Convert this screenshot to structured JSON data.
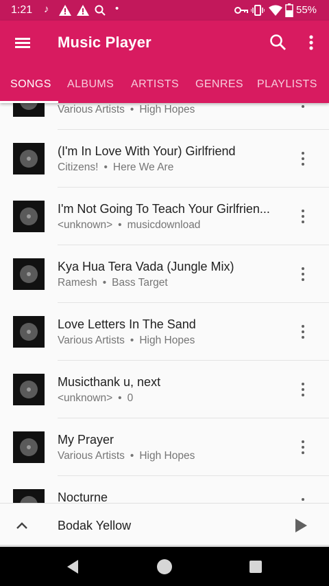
{
  "status_bar": {
    "time": "1:21",
    "battery": "55%",
    "icons": [
      "music-note-icon",
      "warning-icon",
      "warning-icon",
      "search-icon",
      "dot-icon",
      "vpn-key-icon",
      "vibrate-icon",
      "wifi-icon",
      "battery-icon"
    ]
  },
  "app_bar": {
    "title": "Music Player",
    "color": "#d81b60",
    "status_color": "#c2185b",
    "tabs": [
      {
        "label": "SONGS",
        "active": true
      },
      {
        "label": "ALBUMS",
        "active": false
      },
      {
        "label": "ARTISTS",
        "active": false
      },
      {
        "label": "GENRES",
        "active": false
      },
      {
        "label": "PLAYLISTS",
        "active": false
      }
    ]
  },
  "songs": [
    {
      "title": "",
      "artist": "Various Artists",
      "album": "High Hopes"
    },
    {
      "title": "(I'm In Love With Your) Girlfriend",
      "artist": "Citizens!",
      "album": "Here We Are"
    },
    {
      "title": "I'm Not Going To Teach Your Girlfrien...",
      "artist": "<unknown>",
      "album": "musicdownload"
    },
    {
      "title": "Kya Hua Tera Vada (Jungle Mix)",
      "artist": "Ramesh",
      "album": "Bass Target"
    },
    {
      "title": "Love Letters In The Sand",
      "artist": "Various Artists",
      "album": "High Hopes"
    },
    {
      "title": "Musicthank u, next",
      "artist": "<unknown>",
      "album": "0"
    },
    {
      "title": "My Prayer",
      "artist": "Various Artists",
      "album": "High Hopes"
    },
    {
      "title": "Nocturne",
      "artist": "",
      "album": ""
    }
  ],
  "separator": "•",
  "now_playing": {
    "title": "Bodak Yellow"
  }
}
